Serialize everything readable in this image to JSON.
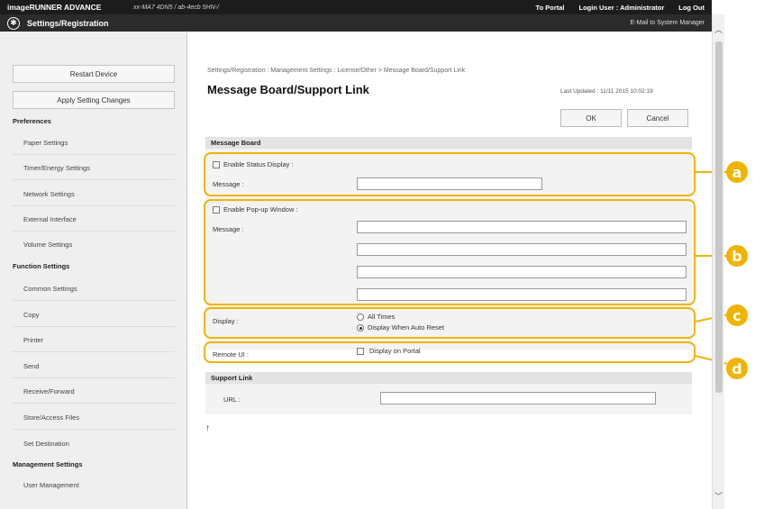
{
  "header": {
    "brand": "imageRUNNER ADVANCE",
    "device": "xx-MA7 4DN5 / ab-4ecb 5HN-/",
    "to_portal": "To Portal",
    "login_user": "Login User :",
    "user_name": "Administrator",
    "logout": "Log Out",
    "app_title": "Settings/Registration",
    "email_manager": "E-Mail to System Manager"
  },
  "sidebar": {
    "restart": "Restart Device",
    "apply": "Apply Setting Changes",
    "preferences_heading": "Preferences",
    "preferences_items": [
      "Paper Settings",
      "Timer/Energy Settings",
      "Network Settings",
      "External Interface",
      "Volume Settings"
    ],
    "function_heading": "Function Settings",
    "function_items": [
      "Common Settings",
      "Copy",
      "Printer",
      "Send",
      "Receive/Forward",
      "Store/Access Files",
      "Set Destination"
    ],
    "management_heading": "Management Settings",
    "management_items": [
      "User Management"
    ]
  },
  "main": {
    "breadcrumb": "Settings/Registration : Management Settings : License/Other > Message Board/Support Link",
    "title": "Message Board/Support Link",
    "last_updated": "Last Updated : 11/11 2015 10:02:19",
    "ok": "OK",
    "cancel": "Cancel",
    "message_board_heading": "Message Board",
    "enable_status": "Enable Status Display :",
    "message_label": "Message :",
    "enable_popup": "Enable Pop-up Window :",
    "message_label2": "Message :",
    "display_label": "Display :",
    "display_options": [
      "All Times",
      "Display When Auto Reset"
    ],
    "display_selected": "Display When Auto Reset",
    "remote_ui_label": "Remote UI :",
    "display_on_portal": "Display on Portal",
    "support_link_heading": "Support Link",
    "url_label": "URL :",
    "top_link": "↑"
  },
  "callouts": [
    "a",
    "b",
    "c",
    "d"
  ],
  "colors": {
    "accent": "#f0b400",
    "topbar": "#1c1c1c",
    "titlebar": "#2b2b2b"
  }
}
